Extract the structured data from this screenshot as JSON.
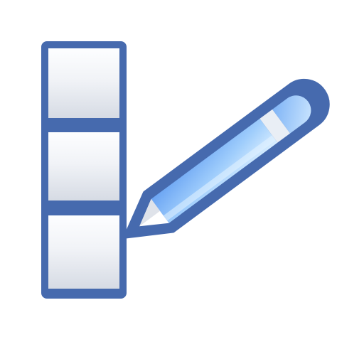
{
  "icon": {
    "name": "edit-list-icon",
    "parts": [
      "column-stack",
      "pencil"
    ]
  },
  "colors": {
    "outline": "#466aae",
    "cell_top": "#fdfeff",
    "cell_bottom": "#d9dde6",
    "pencil_body_light": "#d5ecff",
    "pencil_body_dark": "#6aa4f3",
    "pencil_ferrule": "#e9eef5",
    "pencil_tip": "#ffffff",
    "background": "#ffffff"
  }
}
